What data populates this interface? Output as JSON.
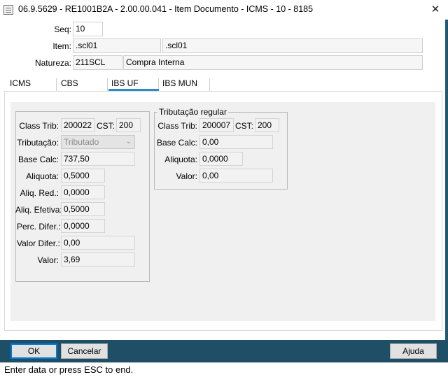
{
  "window": {
    "title": "06.9.5629 - RE1001B2A - 2.00.00.041 - Item Documento - ICMS - 10 - 8185",
    "close_glyph": "✕"
  },
  "header": {
    "seq_label": "Seq:",
    "seq_value": "10",
    "item_label": "Item:",
    "item_code": ".scl01",
    "item_desc": ".scl01",
    "natureza_label": "Natureza:",
    "natureza_code": "211SCL",
    "natureza_desc": "Compra Interna"
  },
  "tabs": [
    {
      "label": "ICMS"
    },
    {
      "label": "CBS"
    },
    {
      "label": "IBS UF",
      "active": true
    },
    {
      "label": "IBS MUN"
    }
  ],
  "left_group": {
    "class_trib_label": "Class Trib:",
    "class_trib_value": "200022",
    "cst_label": "CST:",
    "cst_value": "200",
    "tributacao_label": "Tributação:",
    "tributacao_value": "Tributado",
    "base_calc_label": "Base Calc:",
    "base_calc_value": "737,50",
    "aliquota_label": "Aliquota:",
    "aliquota_value": "0,5000",
    "aliq_red_label": "Aliq. Red.:",
    "aliq_red_value": "0,0000",
    "aliq_efetiva_label": "Aliq. Efetiva:",
    "aliq_efetiva_value": "0,5000",
    "perc_difer_label": "Perc. Difer.:",
    "perc_difer_value": "0,0000",
    "valor_difer_label": "Valor Difer.:",
    "valor_difer_value": "0,00",
    "valor_label": "Valor:",
    "valor_value": "3,69"
  },
  "right_group": {
    "title": "Tributação regular",
    "class_trib_label": "Class Trib:",
    "class_trib_value": "200007",
    "cst_label": "CST:",
    "cst_value": "200",
    "base_calc_label": "Base Calc:",
    "base_calc_value": "0,00",
    "aliquota_label": "Aliquota:",
    "aliquota_value": "0,0000",
    "valor_label": "Valor:",
    "valor_value": "0,00"
  },
  "footer": {
    "ok_label": "OK",
    "cancel_label": "Cancelar",
    "help_label": "Ajuda"
  },
  "status": {
    "text": "Enter data or press ESC to end."
  },
  "colors": {
    "footer_bg": "#1e4f66",
    "tab_accent": "#2d8cc8"
  }
}
